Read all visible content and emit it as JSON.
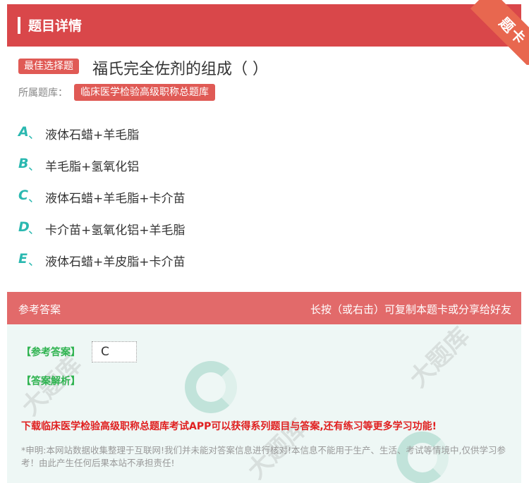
{
  "header": {
    "title": "题目详情",
    "corner_label": "题卡"
  },
  "question": {
    "type_badge": "最佳选择题",
    "title": "福氏完全佐剂的组成（ ）",
    "library_label": "所属题库：",
    "library_name": "临床医学检验高级职称总题库"
  },
  "options": [
    {
      "letter": "A",
      "sep": "、",
      "text": "液体石蜡+羊毛脂"
    },
    {
      "letter": "B",
      "sep": "、",
      "text": "羊毛脂+氢氧化铝"
    },
    {
      "letter": "C",
      "sep": "、",
      "text": "液体石蜡+羊毛脂+卡介苗"
    },
    {
      "letter": "D",
      "sep": "、",
      "text": "卡介苗+氢氧化铝+羊毛脂"
    },
    {
      "letter": "E",
      "sep": "、",
      "text": "液体石蜡+羊皮脂+卡介苗"
    }
  ],
  "answer": {
    "section_title": "参考答案",
    "copy_hint": "长按（或右击）可复制本题卡或分享给好友",
    "ref_label": "【参考答案】",
    "ref_value": "C",
    "analysis_label": "【答案解析】",
    "download_text": "下载临床医学检验高级职称总题库考试APP可以获得系列题目与答案,还有练习等更多学习功能!",
    "disclaimer": "*申明:本网站数据收集整理于互联网!我们并未能对答案信息进行核对!本信息不能用于生产、生活、考试等情境中,仅供学习参考！由此产生任何后果本站不承担责任!"
  },
  "colors": {
    "primary_red": "#d9474a",
    "answer_header": "#e26a6a",
    "option_letter": "#2ab8b0",
    "answer_green": "#2fb350",
    "download_red": "#e02020"
  }
}
